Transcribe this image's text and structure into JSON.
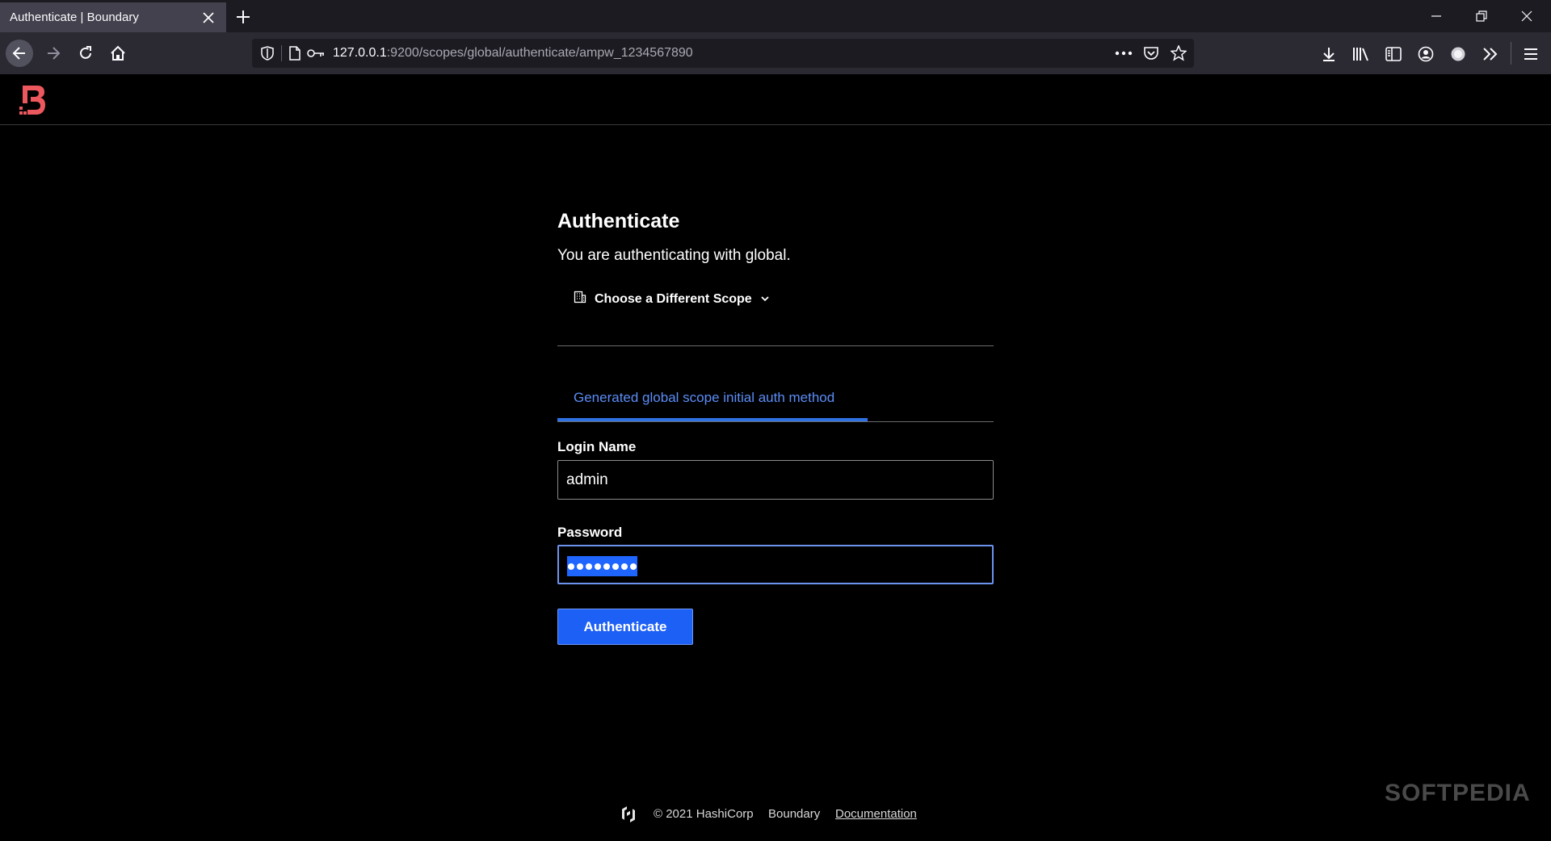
{
  "browser": {
    "tab_title": "Authenticate | Boundary",
    "url_host": "127.0.0.1",
    "url_rest": ":9200/scopes/global/authenticate/ampw_1234567890"
  },
  "page": {
    "title": "Authenticate",
    "subtitle": "You are authenticating with global.",
    "scope_button": "Choose a Different Scope",
    "auth_method_tab": "Generated global scope initial auth method"
  },
  "form": {
    "login_label": "Login Name",
    "login_value": "admin",
    "password_label": "Password",
    "password_dots": 8,
    "submit_label": "Authenticate"
  },
  "footer": {
    "copyright": "© 2021 HashiCorp",
    "product": "Boundary",
    "docs_link": "Documentation"
  },
  "watermark": "SOFTPEDIA",
  "colors": {
    "accent": "#1d60f5",
    "tab_active": "#5c8df6",
    "brand": "#ec585d"
  },
  "icons": [
    "close-icon",
    "plus-icon",
    "minimize-icon",
    "restore-icon",
    "back-icon",
    "forward-icon",
    "reload-icon",
    "home-icon",
    "shield-icon",
    "page-icon",
    "key-icon",
    "more-icon",
    "pocket-icon",
    "star-icon",
    "download-icon",
    "library-icon",
    "sidebar-icon",
    "account-icon",
    "extension-icon",
    "overflow-icon",
    "menu-icon",
    "boundary-logo",
    "building-icon",
    "chevron-down-icon",
    "hashicorp-logo"
  ]
}
